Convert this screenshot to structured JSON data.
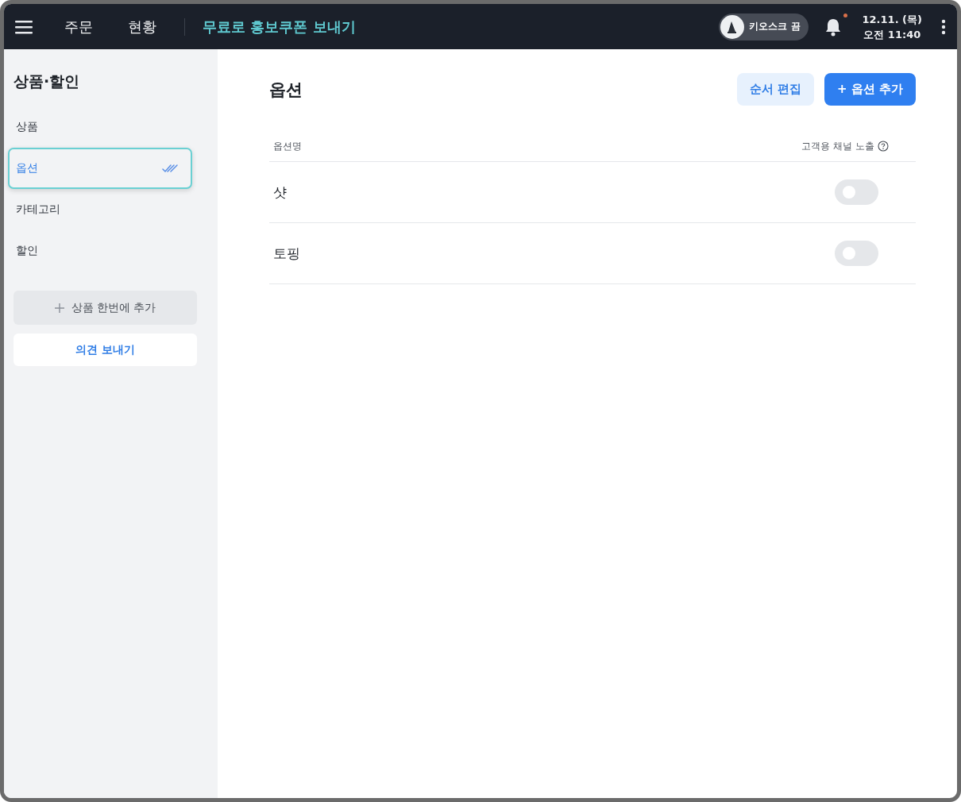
{
  "top_bar": {
    "nav": [
      {
        "label": "주문",
        "selected": false
      },
      {
        "label": "현황",
        "selected": false
      }
    ],
    "promo_link": "무료로 홍보쿠폰 보내기",
    "kiosk": {
      "label": "키오스크 끔",
      "on": false
    },
    "notification": {
      "unread": true
    },
    "date": "12.11. (목)",
    "time": "오전 11:40"
  },
  "sidebar": {
    "title": "상품·할인",
    "items": [
      {
        "label": "상품",
        "selected": false
      },
      {
        "label": "옵션",
        "selected": true
      },
      {
        "label": "카테고리",
        "selected": false
      },
      {
        "label": "할인",
        "selected": false
      }
    ],
    "bulk_add_button": "상품 한번에 추가",
    "feedback_button": "의견 보내기"
  },
  "main": {
    "title": "옵션",
    "buttons": [
      {
        "label": "순서 편집",
        "kind": "secondary"
      },
      {
        "label": "+ 옵션 추가",
        "kind": "primary"
      }
    ],
    "table": {
      "columns": [
        "옵션명",
        "고객용 채널 노출"
      ],
      "rows": [
        {
          "name": "샷",
          "exposed": false
        },
        {
          "name": "토핑",
          "exposed": false
        }
      ]
    }
  }
}
